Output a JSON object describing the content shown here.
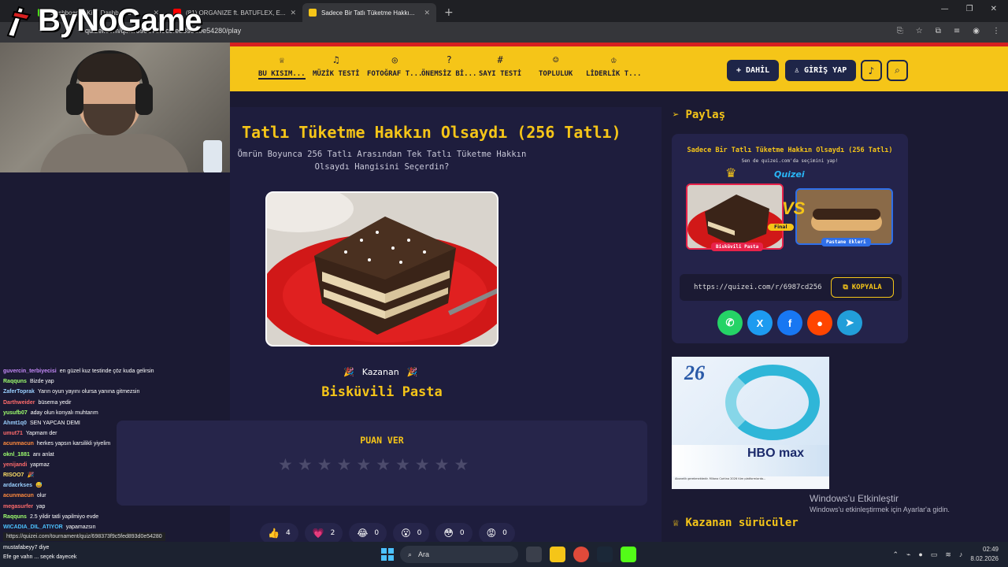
{
  "browser": {
    "tabs": [
      {
        "title": "Dashboard - Kick Dashboard",
        "fav_color": "#53fc18",
        "active": false
      },
      {
        "title": "(81) ORGANIZE ft. BATUFLEX, E...",
        "fav_color": "#ff0000",
        "active": false
      },
      {
        "title": "Sadece Bir Tatlı Tüketme Hakkı...",
        "fav_color": "#f5c518",
        "active": true
      }
    ],
    "url": "quizei.com/quiz/698373f9c5fed893d0e54280/play"
  },
  "stream": {
    "logo_text": "ByNoGame"
  },
  "site_nav": {
    "items": [
      {
        "label": "BU KISIM...",
        "icon": "trophy-icon",
        "glyph": "♕",
        "active": true
      },
      {
        "label": "MÜZİK TESTİ",
        "icon": "music-icon",
        "glyph": "♫",
        "active": false
      },
      {
        "label": "FOTOĞRAF T...",
        "icon": "camera-icon",
        "glyph": "◎",
        "active": false
      },
      {
        "label": "ÖNEMSİZ Bİ...",
        "icon": "question-icon",
        "glyph": "?",
        "active": false
      },
      {
        "label": "SAYI TESTİ",
        "icon": "hash-icon",
        "glyph": "#",
        "active": false
      },
      {
        "label": "TOPLULUK",
        "icon": "users-icon",
        "glyph": "☺",
        "active": false
      },
      {
        "label": "LİDERLİK T...",
        "icon": "medal-icon",
        "glyph": "♔",
        "active": false
      }
    ],
    "join_label": "DAHİL",
    "login_label": "GİRİŞ YAP"
  },
  "quiz": {
    "title": "Tatlı Tüketme Hakkın Olsaydı (256 Tatlı)",
    "subtitle": "Ömrün Boyunca 256 Tatlı Arasından Tek Tatlı Tüketme Hakkın Olsaydı Hangisini Seçerdin?",
    "winner_label": "Kazanan",
    "winner_name": "Bisküvili Pasta",
    "rate_title": "PUAN VER",
    "stars_total": 10,
    "stars_filled": 0
  },
  "reactions": [
    {
      "emoji": "👍",
      "count": "4"
    },
    {
      "emoji": "💗",
      "count": "2"
    },
    {
      "emoji": "😂",
      "count": "0"
    },
    {
      "emoji": "😮",
      "count": "0"
    },
    {
      "emoji": "😳",
      "count": "0"
    },
    {
      "emoji": "😡",
      "count": "0"
    }
  ],
  "share": {
    "heading": "Paylaş",
    "preview_title": "Sadece Bir Tatlı Tüketme Hakkın Olsaydı (256 Tatlı)",
    "preview_sub": "Sen de quizei.com'da seçimini yap!",
    "brand": "Quizei",
    "final_label": "Final",
    "left_item": "Bisküvili Pasta",
    "right_item": "Pastane Ekleri",
    "link": "https://quizei.com/r/6987cd256",
    "copy_label": "KOPYALA",
    "socials": [
      {
        "name": "whatsapp",
        "color": "#25d366",
        "glyph": "✆"
      },
      {
        "name": "x",
        "color": "#1d9bf0",
        "glyph": "X"
      },
      {
        "name": "facebook",
        "color": "#1877f2",
        "glyph": "f"
      },
      {
        "name": "reddit",
        "color": "#ff4500",
        "glyph": "●"
      },
      {
        "name": "telegram",
        "color": "#229ed9",
        "glyph": "➤"
      }
    ]
  },
  "ad": {
    "year": "26",
    "brand": "HBO max",
    "note": "Abonelik gerekmektedir. Milano Cortina 2026 tüm platformlarda..."
  },
  "windows": {
    "activate_title": "Windows'u Etkinleştir",
    "activate_sub": "Windows'u etkinleştirmek için Ayarlar'a gidin."
  },
  "drivers_heading": "Kazanan sürücüler",
  "chat": [
    {
      "user": "guvercin_terbiyecisi",
      "color": "#c58af9",
      "msg": "en güzel kuz testinde çöz kuda gelirsin"
    },
    {
      "user": "Raqquns",
      "color": "#9eff6e",
      "msg": "Bizde yap"
    },
    {
      "user": "ZaferToprak",
      "color": "#9ad0ff",
      "msg": "Yarın oyun yayını olursa yanına gitmezsin"
    },
    {
      "user": "Darthweider",
      "color": "#ff6b6b",
      "msg": "büsema yedir"
    },
    {
      "user": "yusufb07",
      "color": "#9eff6e",
      "msg": "aday olun konyalı muhtarım"
    },
    {
      "user": "Ahmt1q0",
      "color": "#9ad0ff",
      "msg": "SEN YAPCAN DEMI"
    },
    {
      "user": "umut71",
      "color": "#ff6b6b",
      "msg": "Yapmam der"
    },
    {
      "user": "acunmacun",
      "color": "#ff8a3d",
      "msg": "herkes yapsın karsilikli yiyelim"
    },
    {
      "user": "oknl_1881",
      "color": "#9eff6e",
      "msg": "anı anlat"
    },
    {
      "user": "yenijandi",
      "color": "#ff6b6b",
      "msg": "yapmaz"
    },
    {
      "user": "RISOO7",
      "color": "#ffe066",
      "msg": "🎉"
    },
    {
      "user": "ardacrkses",
      "color": "#9ad0ff",
      "msg": "😅"
    },
    {
      "user": "acunmacun",
      "color": "#ff8a3d",
      "msg": "olur"
    },
    {
      "user": "megasurfer",
      "color": "#ff6b6b",
      "msg": "yap"
    },
    {
      "user": "Raqquns",
      "color": "#9eff6e",
      "msg": "2.5 yildir tatli yapilmiyo evde"
    },
    {
      "user": "WICADIA_DIL_ATIYOR",
      "color": "#4cc2ff",
      "msg": "yapamazsın"
    }
  ],
  "status_url": "https://quizei.com/tournament/quiz/698373f9c5fed893d0e54280",
  "taskbar": {
    "search_placeholder": "Ara",
    "time": "02:49",
    "date": "8.02.2026",
    "chat_lines": [
      "mustafabeyy7 diye",
      "Efe ge vahn ... seçek dayecek"
    ]
  }
}
